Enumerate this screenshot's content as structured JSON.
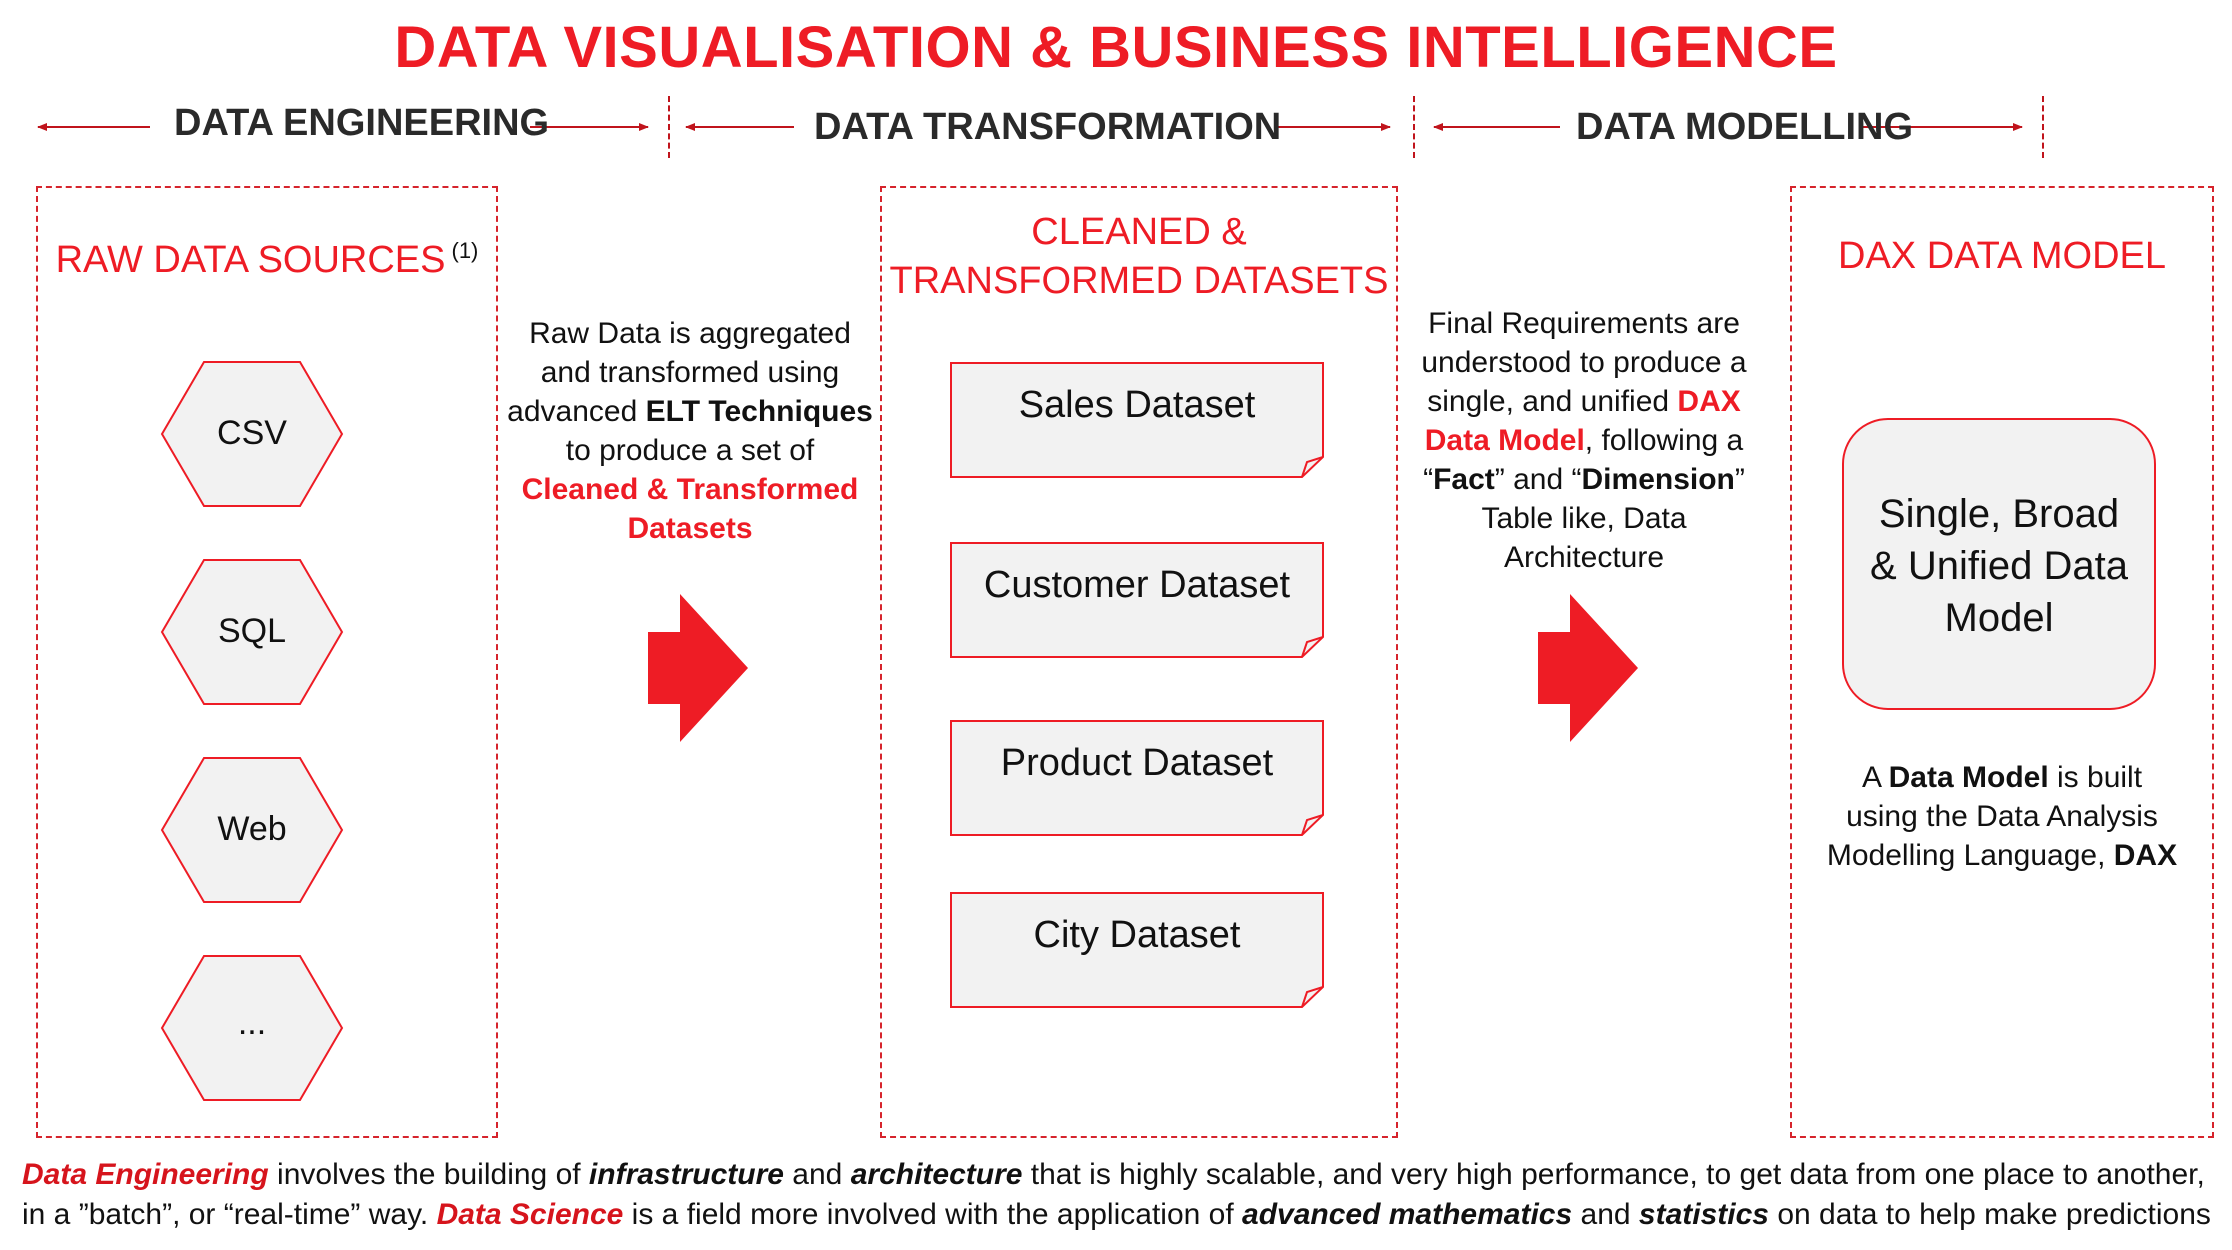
{
  "title": "DATA VISUALISATION & BUSINESS INTELLIGENCE",
  "phases": {
    "engineering": "DATA ENGINEERING",
    "transformation": "DATA TRANSFORMATION",
    "modelling": "DATA MODELLING"
  },
  "sources": {
    "title": "RAW DATA SOURCES",
    "footnote_marker": "(1)",
    "items": [
      "CSV",
      "SQL",
      "Web",
      "..."
    ]
  },
  "etl_note": {
    "line1": "Raw Data is aggregated",
    "line2": "and transformed using",
    "line3_a": "advanced ",
    "line3_b": "ELT Techniques",
    "line4": "to produce a set of",
    "line5": "Cleaned & Transformed",
    "line6": "Datasets"
  },
  "datasets": {
    "title_line1": "CLEANED &",
    "title_line2": "TRANSFORMED DATASETS",
    "items": [
      "Sales Dataset",
      "Customer Dataset",
      "Product Dataset",
      "City Dataset"
    ]
  },
  "model_note": {
    "line1": "Final Requirements are",
    "line2": "understood to produce a",
    "line3_a": "single, and unified ",
    "line3_b": "DAX",
    "line4_a": "Data Model",
    "line4_b": ", following a",
    "line5_a": "“",
    "line5_b": "Fact",
    "line5_c": "” and “",
    "line5_d": "Dimension",
    "line5_e": "”",
    "line6": "Table like, Data",
    "line7": "Architecture"
  },
  "dax": {
    "title": "DAX DATA MODEL",
    "box_line1": "Single, Broad",
    "box_line2": "& Unified Data",
    "box_line3": "Model",
    "caption_a": "A ",
    "caption_b": "Data Model",
    "caption_c": " is built",
    "caption_line2": "using the Data Analysis",
    "caption_line3_a": "Modelling Language, ",
    "caption_line3_b": "DAX"
  },
  "footer": {
    "p1": "Data Engineering",
    "p2": " involves the building of ",
    "p3": "infrastructure",
    "p4": " and ",
    "p5": "architecture",
    "p6": " that is highly scalable, and very high performance, to get data from one place to another,",
    "p7": "in a ”batch”, or “real-time” way. ",
    "p8": "Data Science",
    "p9": " is a field more involved with the application of ",
    "p10": "advanced mathematics",
    "p11": " and ",
    "p12": "statistics",
    "p13": " on data to help make predictions"
  },
  "colors": {
    "accent": "#ee1c25",
    "box_fill": "#f2f2f2",
    "text": "#111111"
  }
}
